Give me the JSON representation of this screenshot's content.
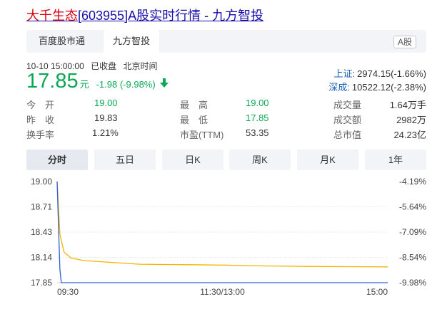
{
  "title": {
    "name": "大千生态",
    "rest": "[603955]A股实时行情 - 九方智投"
  },
  "tabs": {
    "t1": "百度股市通",
    "t2": "九方智投",
    "badge": "A股"
  },
  "meta": {
    "time": "10-10 15:00:00",
    "status": "已收盘",
    "tz": "北京时间"
  },
  "quote": {
    "price": "17.85",
    "unit": "元",
    "change": "-1.98 (-9.98%)"
  },
  "indices": [
    {
      "name": "上证:",
      "value": "2974.15(-1.66%)"
    },
    {
      "name": "深成:",
      "value": "10522.12(-2.38%)"
    }
  ],
  "stats": {
    "open_label": "今　开",
    "open": "19.00",
    "high_label": "最　高",
    "high": "19.00",
    "volume_label": "成交量",
    "volume": "1.64万手",
    "prev_label": "昨　收",
    "prev": "19.83",
    "low_label": "最　低",
    "low": "17.85",
    "amount_label": "成交额",
    "amount": "2982万",
    "turnover_label": "换手率",
    "turnover": "1.21%",
    "pe_label": "市盈(TTM)",
    "pe": "53.35",
    "cap_label": "总市值",
    "cap": "24.23亿"
  },
  "periods": [
    "分时",
    "五日",
    "日K",
    "周K",
    "月K",
    "1年"
  ],
  "chart_data": {
    "type": "line",
    "y_ticks": [
      "19.00",
      "18.71",
      "18.43",
      "18.14",
      "17.85"
    ],
    "pct_ticks": [
      "-4.19%",
      "-5.64%",
      "-7.09%",
      "-8.54%",
      "-9.98%"
    ],
    "x_ticks": [
      "09:30",
      "11:30/13:00",
      "15:00"
    ],
    "ylim": [
      17.85,
      19.0
    ],
    "series": [
      {
        "color": "#f5b400",
        "x": [
          0,
          2,
          5,
          10,
          20,
          40,
          60,
          120,
          150,
          180,
          240
        ],
        "values": [
          19.0,
          18.4,
          18.2,
          18.13,
          18.1,
          18.08,
          18.06,
          18.05,
          18.04,
          18.035,
          18.03
        ]
      },
      {
        "color": "#2f5fd9",
        "x": [
          0,
          1,
          2,
          3,
          240
        ],
        "values": [
          19.0,
          18.5,
          18.0,
          17.85,
          17.85
        ]
      }
    ],
    "colors": {
      "up": "#e60012",
      "down": "#0aa854",
      "avg": "#f5b400",
      "price": "#2f5fd9"
    }
  }
}
